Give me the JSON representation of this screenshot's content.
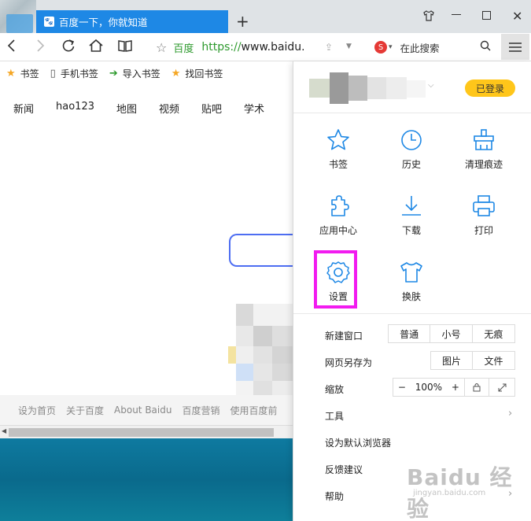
{
  "browser": {
    "tab_title": "百度一下，你就知道",
    "new_tab": "+",
    "site_name": "百度",
    "url_scheme": "https://",
    "url_rest": "www.baidu.c",
    "search_placeholder": "在此搜索"
  },
  "bookmarks": [
    {
      "label": "书签",
      "icon": "star-icon"
    },
    {
      "label": "手机书签",
      "icon": "phone-icon"
    },
    {
      "label": "导入书签",
      "icon": "import-icon"
    },
    {
      "label": "找回书签",
      "icon": "star-icon"
    }
  ],
  "page": {
    "nav": [
      "新闻",
      "hao123",
      "地图",
      "视频",
      "贴吧",
      "学术"
    ],
    "footer": [
      "设为首页",
      "关于百度",
      "About Baidu",
      "百度营销",
      "使用百度前"
    ]
  },
  "menu": {
    "login_badge": "已登录",
    "grid": [
      {
        "label": "书签",
        "icon": "star-icon"
      },
      {
        "label": "历史",
        "icon": "clock-icon"
      },
      {
        "label": "清理痕迹",
        "icon": "broom-icon"
      },
      {
        "label": "应用中心",
        "icon": "puzzle-icon"
      },
      {
        "label": "下载",
        "icon": "download-icon"
      },
      {
        "label": "打印",
        "icon": "printer-icon"
      },
      {
        "label": "设置",
        "icon": "gear-icon"
      },
      {
        "label": "换肤",
        "icon": "shirt-icon"
      }
    ],
    "new_window": {
      "label": "新建窗口",
      "options": [
        "普通",
        "小号",
        "无痕"
      ]
    },
    "save_as": {
      "label": "网页另存为",
      "options": [
        "图片",
        "文件"
      ]
    },
    "zoom": {
      "label": "缩放",
      "minus": "−",
      "value": "100%",
      "plus": "+"
    },
    "items": [
      "工具",
      "设为默认浏览器",
      "反馈建议",
      "帮助"
    ]
  },
  "watermark": {
    "main": "Baidu 经验",
    "sub": "jingyan.baidu.com"
  },
  "colors": {
    "tab_blue": "#1e88e5",
    "login_yellow": "#ffc61a",
    "highlight": "#f21bf0",
    "icon_blue": "#1e88e5",
    "https_green": "#2e9a2e"
  }
}
